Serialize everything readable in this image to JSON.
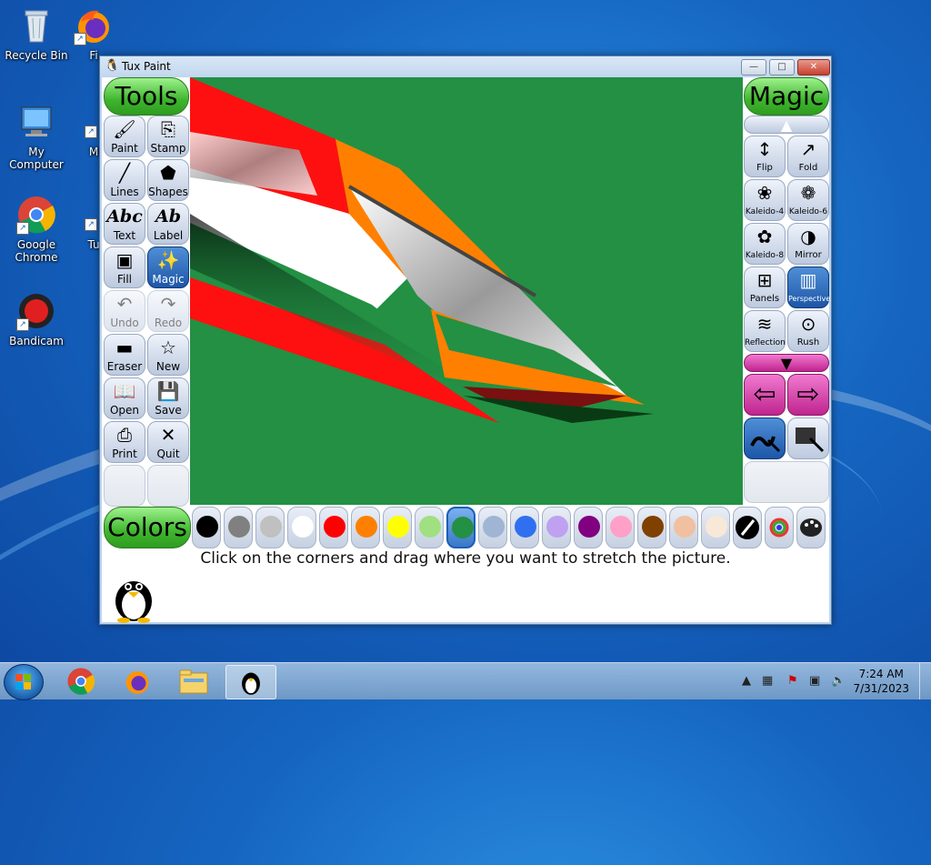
{
  "desktop": {
    "icons": [
      {
        "label": "Recycle Bin"
      },
      {
        "label": "Fi"
      },
      {
        "label": "My Computer"
      },
      {
        "label": "M"
      },
      {
        "label": "Google Chrome"
      },
      {
        "label": "Tu"
      },
      {
        "label": "Bandicam"
      }
    ]
  },
  "window": {
    "title": "Tux Paint",
    "minimize": "—",
    "maximize": "□",
    "close": "✕"
  },
  "tools": {
    "header": "Tools",
    "items": [
      {
        "label": "Paint",
        "icon": "🖌"
      },
      {
        "label": "Stamp",
        "icon": "⎘"
      },
      {
        "label": "Lines",
        "icon": "╱"
      },
      {
        "label": "Shapes",
        "icon": "⬟"
      },
      {
        "label": "Text",
        "icon": "Abc"
      },
      {
        "label": "Label",
        "icon": "Ab"
      },
      {
        "label": "Fill",
        "icon": "▣"
      },
      {
        "label": "Magic",
        "icon": "✨"
      },
      {
        "label": "Undo",
        "icon": "↶"
      },
      {
        "label": "Redo",
        "icon": "↷"
      },
      {
        "label": "Eraser",
        "icon": "▬"
      },
      {
        "label": "New",
        "icon": "☆"
      },
      {
        "label": "Open",
        "icon": "📖"
      },
      {
        "label": "Save",
        "icon": "💾"
      },
      {
        "label": "Print",
        "icon": "⎙"
      },
      {
        "label": "Quit",
        "icon": "✕"
      }
    ]
  },
  "magic": {
    "header": "Magic",
    "items": [
      {
        "label": "Flip",
        "icon": "↕"
      },
      {
        "label": "Fold",
        "icon": "↗"
      },
      {
        "label": "Kaleido-4",
        "icon": "❀"
      },
      {
        "label": "Kaleido-6",
        "icon": "❁"
      },
      {
        "label": "Kaleido-8",
        "icon": "✿"
      },
      {
        "label": "Mirror",
        "icon": "◑"
      },
      {
        "label": "Panels",
        "icon": "⊞"
      },
      {
        "label": "Perspective",
        "icon": "▥"
      },
      {
        "label": "Reflection",
        "icon": "≋"
      },
      {
        "label": "Rush",
        "icon": "⊙"
      }
    ],
    "scroll_up": "▲",
    "scroll_down": "▼",
    "left_arrow": "⇦",
    "right_arrow": "⇨"
  },
  "colors": {
    "header": "Colors",
    "swatches": [
      "#000000",
      "#808080",
      "#c0c0c0",
      "#ffffff",
      "#ff0000",
      "#ff8000",
      "#ffff00",
      "#a0e080",
      "#239044",
      "#a0b4d4",
      "#3070f0",
      "#c0a0f0",
      "#800080",
      "#ffa0c8",
      "#804000",
      "#f0c0a0",
      "#f8e8d8"
    ],
    "selected_index": 8
  },
  "instruction": "Click on the corners and drag where you want to stretch the picture.",
  "taskbar": {
    "time": "7:24 AM",
    "date": "7/31/2023"
  }
}
